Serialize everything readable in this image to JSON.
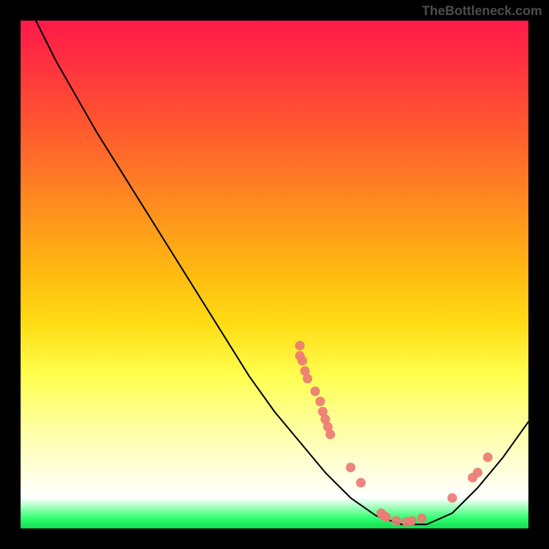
{
  "watermark": "TheBottleneck.com",
  "chart_data": {
    "type": "line",
    "title": "",
    "xlabel": "",
    "ylabel": "",
    "xlim": [
      0,
      100
    ],
    "ylim": [
      0,
      100
    ],
    "gradient_stops": [
      {
        "pos": 0,
        "color": "#ff1a4a"
      },
      {
        "pos": 8,
        "color": "#ff3040"
      },
      {
        "pos": 20,
        "color": "#ff5530"
      },
      {
        "pos": 35,
        "color": "#ff8820"
      },
      {
        "pos": 50,
        "color": "#ffbb10"
      },
      {
        "pos": 60,
        "color": "#ffdd15"
      },
      {
        "pos": 70,
        "color": "#ffff50"
      },
      {
        "pos": 80,
        "color": "#ffffa0"
      },
      {
        "pos": 88,
        "color": "#ffffd8"
      },
      {
        "pos": 94,
        "color": "#ffffff"
      },
      {
        "pos": 98,
        "color": "#30ff70"
      },
      {
        "pos": 100,
        "color": "#10dd50"
      }
    ],
    "curve": [
      {
        "x": 3,
        "y": 100
      },
      {
        "x": 7,
        "y": 92
      },
      {
        "x": 11,
        "y": 85
      },
      {
        "x": 15,
        "y": 78
      },
      {
        "x": 20,
        "y": 70
      },
      {
        "x": 25,
        "y": 62
      },
      {
        "x": 30,
        "y": 54
      },
      {
        "x": 35,
        "y": 46
      },
      {
        "x": 40,
        "y": 38
      },
      {
        "x": 45,
        "y": 30
      },
      {
        "x": 50,
        "y": 23
      },
      {
        "x": 55,
        "y": 17
      },
      {
        "x": 60,
        "y": 11
      },
      {
        "x": 65,
        "y": 6
      },
      {
        "x": 70,
        "y": 2.5
      },
      {
        "x": 75,
        "y": 0.8
      },
      {
        "x": 80,
        "y": 0.8
      },
      {
        "x": 85,
        "y": 3
      },
      {
        "x": 90,
        "y": 8
      },
      {
        "x": 95,
        "y": 14
      },
      {
        "x": 100,
        "y": 21
      }
    ],
    "scatter_points": [
      {
        "x": 55,
        "y": 36
      },
      {
        "x": 55,
        "y": 34
      },
      {
        "x": 55.5,
        "y": 33
      },
      {
        "x": 56,
        "y": 31
      },
      {
        "x": 56.5,
        "y": 29.5
      },
      {
        "x": 58,
        "y": 27
      },
      {
        "x": 59,
        "y": 25
      },
      {
        "x": 59.5,
        "y": 23
      },
      {
        "x": 60,
        "y": 21.5
      },
      {
        "x": 60.5,
        "y": 20
      },
      {
        "x": 61,
        "y": 18.5
      },
      {
        "x": 65,
        "y": 12
      },
      {
        "x": 67,
        "y": 9
      },
      {
        "x": 71,
        "y": 3
      },
      {
        "x": 71.5,
        "y": 2.5
      },
      {
        "x": 72,
        "y": 2.2
      },
      {
        "x": 74,
        "y": 1.5
      },
      {
        "x": 76,
        "y": 1.3
      },
      {
        "x": 77,
        "y": 1.5
      },
      {
        "x": 79,
        "y": 2
      },
      {
        "x": 85,
        "y": 6
      },
      {
        "x": 89,
        "y": 10
      },
      {
        "x": 90,
        "y": 11
      },
      {
        "x": 92,
        "y": 14
      }
    ]
  }
}
